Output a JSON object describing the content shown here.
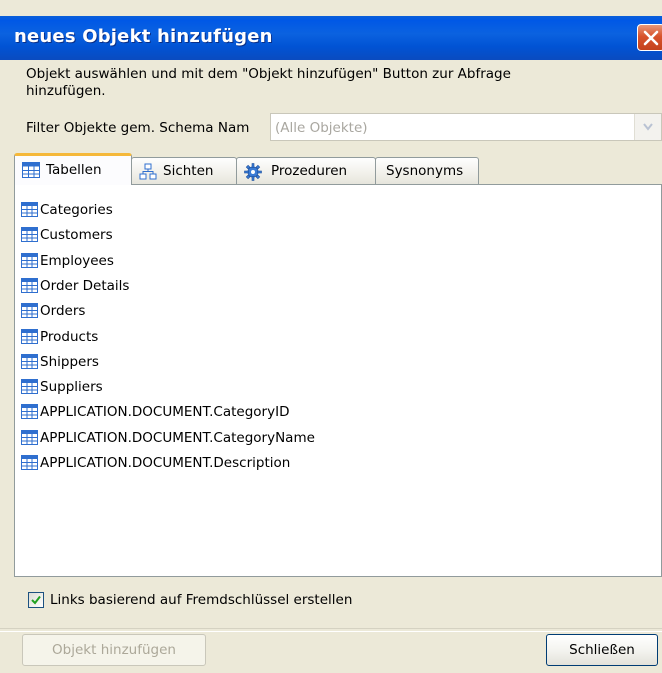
{
  "window": {
    "title": "neues Objekt hinzufügen"
  },
  "description": "Objekt auswählen und mit dem \"Objekt hinzufügen\" Button zur Abfrage hinzufügen.",
  "filter": {
    "label": "Filter Objekte gem. Schema Nam",
    "value": "(Alle Objekte)"
  },
  "tabs": [
    {
      "label": "Tabellen",
      "icon": "table-icon",
      "active": true
    },
    {
      "label": "Sichten",
      "icon": "view-icon",
      "active": false
    },
    {
      "label": "Prozeduren",
      "icon": "procedure-gear-icon",
      "active": false
    },
    {
      "label": "Sysnonyms",
      "icon": "",
      "active": false
    }
  ],
  "items": [
    "Categories",
    "Customers",
    "Employees",
    "Order Details",
    "Orders",
    "Products",
    "Shippers",
    "Suppliers",
    "APPLICATION.DOCUMENT.CategoryID",
    "APPLICATION.DOCUMENT.CategoryName",
    "APPLICATION.DOCUMENT.Description"
  ],
  "checkbox": {
    "label": "Links basierend auf Fremdschlüssel erstellen",
    "checked": true
  },
  "buttons": {
    "add_label": "Objekt hinzufügen",
    "close_label": "Schließen"
  },
  "colors": {
    "titlebar": "#0058e6",
    "active_tab_accent": "#f5b83a",
    "table_icon": "#2f6fcf"
  }
}
